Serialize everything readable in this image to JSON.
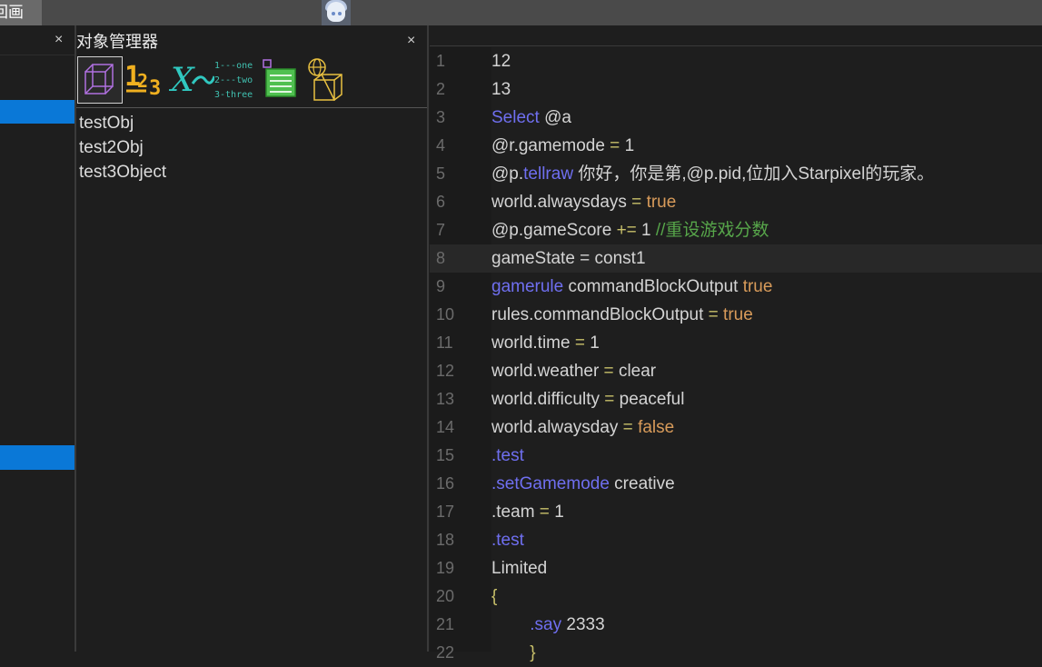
{
  "top_tab": "回画",
  "object_manager": {
    "title": "对象管理器",
    "close": "×",
    "objects": [
      "testObj",
      "test2Obj",
      "test3Object"
    ],
    "icons": [
      "cube-icon",
      "numbers-icon",
      "variable-icon",
      "list-icon",
      "document-icon",
      "box-globe-icon"
    ],
    "numbers_icon_text": "1₂3",
    "variable_icon_text": "X",
    "list_icon_lines": [
      "1---one",
      "2---two",
      "3-three"
    ]
  },
  "left_panel": {
    "close": "×"
  },
  "editor": {
    "line_numbers": [
      "1",
      "2",
      "3",
      "4",
      "5",
      "6",
      "7",
      "8",
      "9",
      "10",
      "11",
      "12",
      "13",
      "14",
      "15",
      "16",
      "17",
      "18",
      "19",
      "20",
      "21",
      "22"
    ],
    "lines": [
      [
        {
          "t": "12",
          "c": "w"
        }
      ],
      [
        {
          "t": "13",
          "c": "w"
        }
      ],
      [
        {
          "t": "Select",
          "c": "k"
        },
        {
          "t": " @a",
          "c": "w"
        }
      ],
      [
        {
          "t": "@r.gamemode",
          "c": "w"
        },
        {
          "t": " = ",
          "c": "g"
        },
        {
          "t": "1",
          "c": "w"
        }
      ],
      [
        {
          "t": "@p.",
          "c": "w"
        },
        {
          "t": "tellraw",
          "c": "k"
        },
        {
          "t": " 你好，你是第,@p.pid,位加入Starpixel的玩家。",
          "c": "w"
        }
      ],
      [
        {
          "t": "world.alwaysdays",
          "c": "w"
        },
        {
          "t": " = ",
          "c": "g"
        },
        {
          "t": "true",
          "c": "o"
        }
      ],
      [
        {
          "t": "@p.gameScore",
          "c": "w"
        },
        {
          "t": " += ",
          "c": "g"
        },
        {
          "t": "1 ",
          "c": "w"
        },
        {
          "t": "//重设游戏分数",
          "c": "c"
        }
      ],
      [
        {
          "t": "gameState = const1",
          "c": "w"
        }
      ],
      [
        {
          "t": "gamerule",
          "c": "k"
        },
        {
          "t": " commandBlockOutput ",
          "c": "w"
        },
        {
          "t": "true",
          "c": "o"
        }
      ],
      [
        {
          "t": "rules.commandBlockOutput",
          "c": "w"
        },
        {
          "t": " = ",
          "c": "g"
        },
        {
          "t": "true",
          "c": "o"
        }
      ],
      [
        {
          "t": "world.time",
          "c": "w"
        },
        {
          "t": " = ",
          "c": "g"
        },
        {
          "t": "1",
          "c": "w"
        }
      ],
      [
        {
          "t": "world.weather",
          "c": "w"
        },
        {
          "t": " = ",
          "c": "g"
        },
        {
          "t": "clear",
          "c": "w"
        }
      ],
      [
        {
          "t": "world.difficulty",
          "c": "w"
        },
        {
          "t": " = ",
          "c": "g"
        },
        {
          "t": "peaceful",
          "c": "w"
        }
      ],
      [
        {
          "t": "world.alwaysday",
          "c": "w"
        },
        {
          "t": " = ",
          "c": "g"
        },
        {
          "t": "false",
          "c": "o"
        }
      ],
      [
        {
          "t": ".test",
          "c": "k"
        }
      ],
      [
        {
          "t": ".setGamemode",
          "c": "k"
        },
        {
          "t": " creative",
          "c": "w"
        }
      ],
      [
        {
          "t": ".team",
          "c": "w"
        },
        {
          "t": " = ",
          "c": "g"
        },
        {
          "t": "1",
          "c": "w"
        }
      ],
      [
        {
          "t": ".test",
          "c": "k"
        }
      ],
      [
        {
          "t": "Limited",
          "c": "w"
        }
      ],
      [
        {
          "t": "{",
          "c": "g"
        }
      ],
      [
        {
          "t": "        ",
          "c": "w"
        },
        {
          "t": ".say",
          "c": "k"
        },
        {
          "t": " 2333",
          "c": "w"
        }
      ],
      [
        {
          "t": "        }",
          "c": "g"
        }
      ]
    ],
    "current_line": 8
  },
  "colors": {
    "keyword": "#6f6ff0",
    "operator": "#c8c06a",
    "boolean": "#d89b5a",
    "comment": "#57a64a",
    "selection": "#0a78d7"
  }
}
